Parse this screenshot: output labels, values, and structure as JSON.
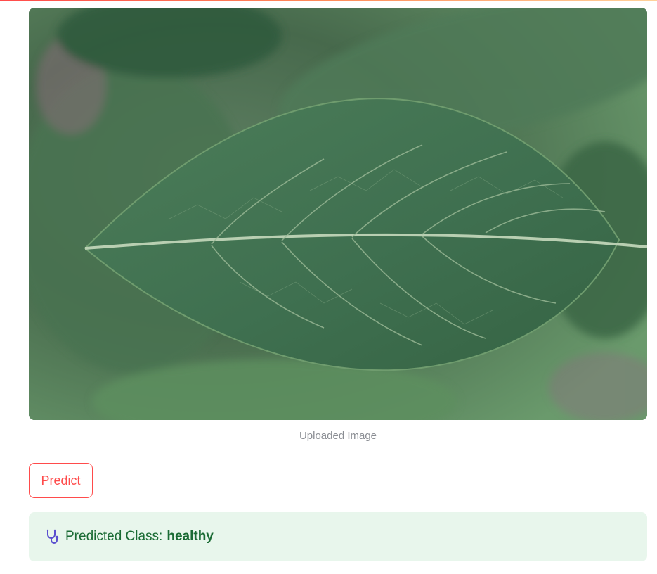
{
  "image": {
    "caption": "Uploaded Image",
    "subject": "green leaf"
  },
  "actions": {
    "predict_label": "Predict"
  },
  "result": {
    "icon": "stethoscope-icon",
    "label": "Predicted Class:",
    "value": "healthy"
  },
  "colors": {
    "accent": "#ff4b4b",
    "success_bg": "#e8f6ec",
    "success_text": "#1a6b34"
  }
}
